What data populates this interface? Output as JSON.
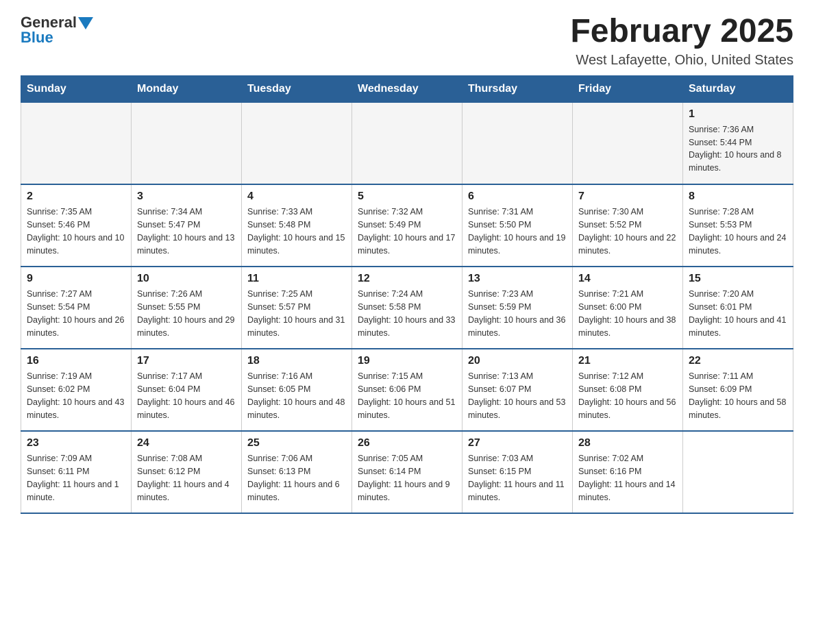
{
  "header": {
    "logo_general": "General",
    "logo_blue": "Blue",
    "month_title": "February 2025",
    "location": "West Lafayette, Ohio, United States"
  },
  "days_of_week": [
    "Sunday",
    "Monday",
    "Tuesday",
    "Wednesday",
    "Thursday",
    "Friday",
    "Saturday"
  ],
  "weeks": [
    [
      {
        "day": "",
        "sunrise": "",
        "sunset": "",
        "daylight": ""
      },
      {
        "day": "",
        "sunrise": "",
        "sunset": "",
        "daylight": ""
      },
      {
        "day": "",
        "sunrise": "",
        "sunset": "",
        "daylight": ""
      },
      {
        "day": "",
        "sunrise": "",
        "sunset": "",
        "daylight": ""
      },
      {
        "day": "",
        "sunrise": "",
        "sunset": "",
        "daylight": ""
      },
      {
        "day": "",
        "sunrise": "",
        "sunset": "",
        "daylight": ""
      },
      {
        "day": "1",
        "sunrise": "Sunrise: 7:36 AM",
        "sunset": "Sunset: 5:44 PM",
        "daylight": "Daylight: 10 hours and 8 minutes."
      }
    ],
    [
      {
        "day": "2",
        "sunrise": "Sunrise: 7:35 AM",
        "sunset": "Sunset: 5:46 PM",
        "daylight": "Daylight: 10 hours and 10 minutes."
      },
      {
        "day": "3",
        "sunrise": "Sunrise: 7:34 AM",
        "sunset": "Sunset: 5:47 PM",
        "daylight": "Daylight: 10 hours and 13 minutes."
      },
      {
        "day": "4",
        "sunrise": "Sunrise: 7:33 AM",
        "sunset": "Sunset: 5:48 PM",
        "daylight": "Daylight: 10 hours and 15 minutes."
      },
      {
        "day": "5",
        "sunrise": "Sunrise: 7:32 AM",
        "sunset": "Sunset: 5:49 PM",
        "daylight": "Daylight: 10 hours and 17 minutes."
      },
      {
        "day": "6",
        "sunrise": "Sunrise: 7:31 AM",
        "sunset": "Sunset: 5:50 PM",
        "daylight": "Daylight: 10 hours and 19 minutes."
      },
      {
        "day": "7",
        "sunrise": "Sunrise: 7:30 AM",
        "sunset": "Sunset: 5:52 PM",
        "daylight": "Daylight: 10 hours and 22 minutes."
      },
      {
        "day": "8",
        "sunrise": "Sunrise: 7:28 AM",
        "sunset": "Sunset: 5:53 PM",
        "daylight": "Daylight: 10 hours and 24 minutes."
      }
    ],
    [
      {
        "day": "9",
        "sunrise": "Sunrise: 7:27 AM",
        "sunset": "Sunset: 5:54 PM",
        "daylight": "Daylight: 10 hours and 26 minutes."
      },
      {
        "day": "10",
        "sunrise": "Sunrise: 7:26 AM",
        "sunset": "Sunset: 5:55 PM",
        "daylight": "Daylight: 10 hours and 29 minutes."
      },
      {
        "day": "11",
        "sunrise": "Sunrise: 7:25 AM",
        "sunset": "Sunset: 5:57 PM",
        "daylight": "Daylight: 10 hours and 31 minutes."
      },
      {
        "day": "12",
        "sunrise": "Sunrise: 7:24 AM",
        "sunset": "Sunset: 5:58 PM",
        "daylight": "Daylight: 10 hours and 33 minutes."
      },
      {
        "day": "13",
        "sunrise": "Sunrise: 7:23 AM",
        "sunset": "Sunset: 5:59 PM",
        "daylight": "Daylight: 10 hours and 36 minutes."
      },
      {
        "day": "14",
        "sunrise": "Sunrise: 7:21 AM",
        "sunset": "Sunset: 6:00 PM",
        "daylight": "Daylight: 10 hours and 38 minutes."
      },
      {
        "day": "15",
        "sunrise": "Sunrise: 7:20 AM",
        "sunset": "Sunset: 6:01 PM",
        "daylight": "Daylight: 10 hours and 41 minutes."
      }
    ],
    [
      {
        "day": "16",
        "sunrise": "Sunrise: 7:19 AM",
        "sunset": "Sunset: 6:02 PM",
        "daylight": "Daylight: 10 hours and 43 minutes."
      },
      {
        "day": "17",
        "sunrise": "Sunrise: 7:17 AM",
        "sunset": "Sunset: 6:04 PM",
        "daylight": "Daylight: 10 hours and 46 minutes."
      },
      {
        "day": "18",
        "sunrise": "Sunrise: 7:16 AM",
        "sunset": "Sunset: 6:05 PM",
        "daylight": "Daylight: 10 hours and 48 minutes."
      },
      {
        "day": "19",
        "sunrise": "Sunrise: 7:15 AM",
        "sunset": "Sunset: 6:06 PM",
        "daylight": "Daylight: 10 hours and 51 minutes."
      },
      {
        "day": "20",
        "sunrise": "Sunrise: 7:13 AM",
        "sunset": "Sunset: 6:07 PM",
        "daylight": "Daylight: 10 hours and 53 minutes."
      },
      {
        "day": "21",
        "sunrise": "Sunrise: 7:12 AM",
        "sunset": "Sunset: 6:08 PM",
        "daylight": "Daylight: 10 hours and 56 minutes."
      },
      {
        "day": "22",
        "sunrise": "Sunrise: 7:11 AM",
        "sunset": "Sunset: 6:09 PM",
        "daylight": "Daylight: 10 hours and 58 minutes."
      }
    ],
    [
      {
        "day": "23",
        "sunrise": "Sunrise: 7:09 AM",
        "sunset": "Sunset: 6:11 PM",
        "daylight": "Daylight: 11 hours and 1 minute."
      },
      {
        "day": "24",
        "sunrise": "Sunrise: 7:08 AM",
        "sunset": "Sunset: 6:12 PM",
        "daylight": "Daylight: 11 hours and 4 minutes."
      },
      {
        "day": "25",
        "sunrise": "Sunrise: 7:06 AM",
        "sunset": "Sunset: 6:13 PM",
        "daylight": "Daylight: 11 hours and 6 minutes."
      },
      {
        "day": "26",
        "sunrise": "Sunrise: 7:05 AM",
        "sunset": "Sunset: 6:14 PM",
        "daylight": "Daylight: 11 hours and 9 minutes."
      },
      {
        "day": "27",
        "sunrise": "Sunrise: 7:03 AM",
        "sunset": "Sunset: 6:15 PM",
        "daylight": "Daylight: 11 hours and 11 minutes."
      },
      {
        "day": "28",
        "sunrise": "Sunrise: 7:02 AM",
        "sunset": "Sunset: 6:16 PM",
        "daylight": "Daylight: 11 hours and 14 minutes."
      },
      {
        "day": "",
        "sunrise": "",
        "sunset": "",
        "daylight": ""
      }
    ]
  ]
}
